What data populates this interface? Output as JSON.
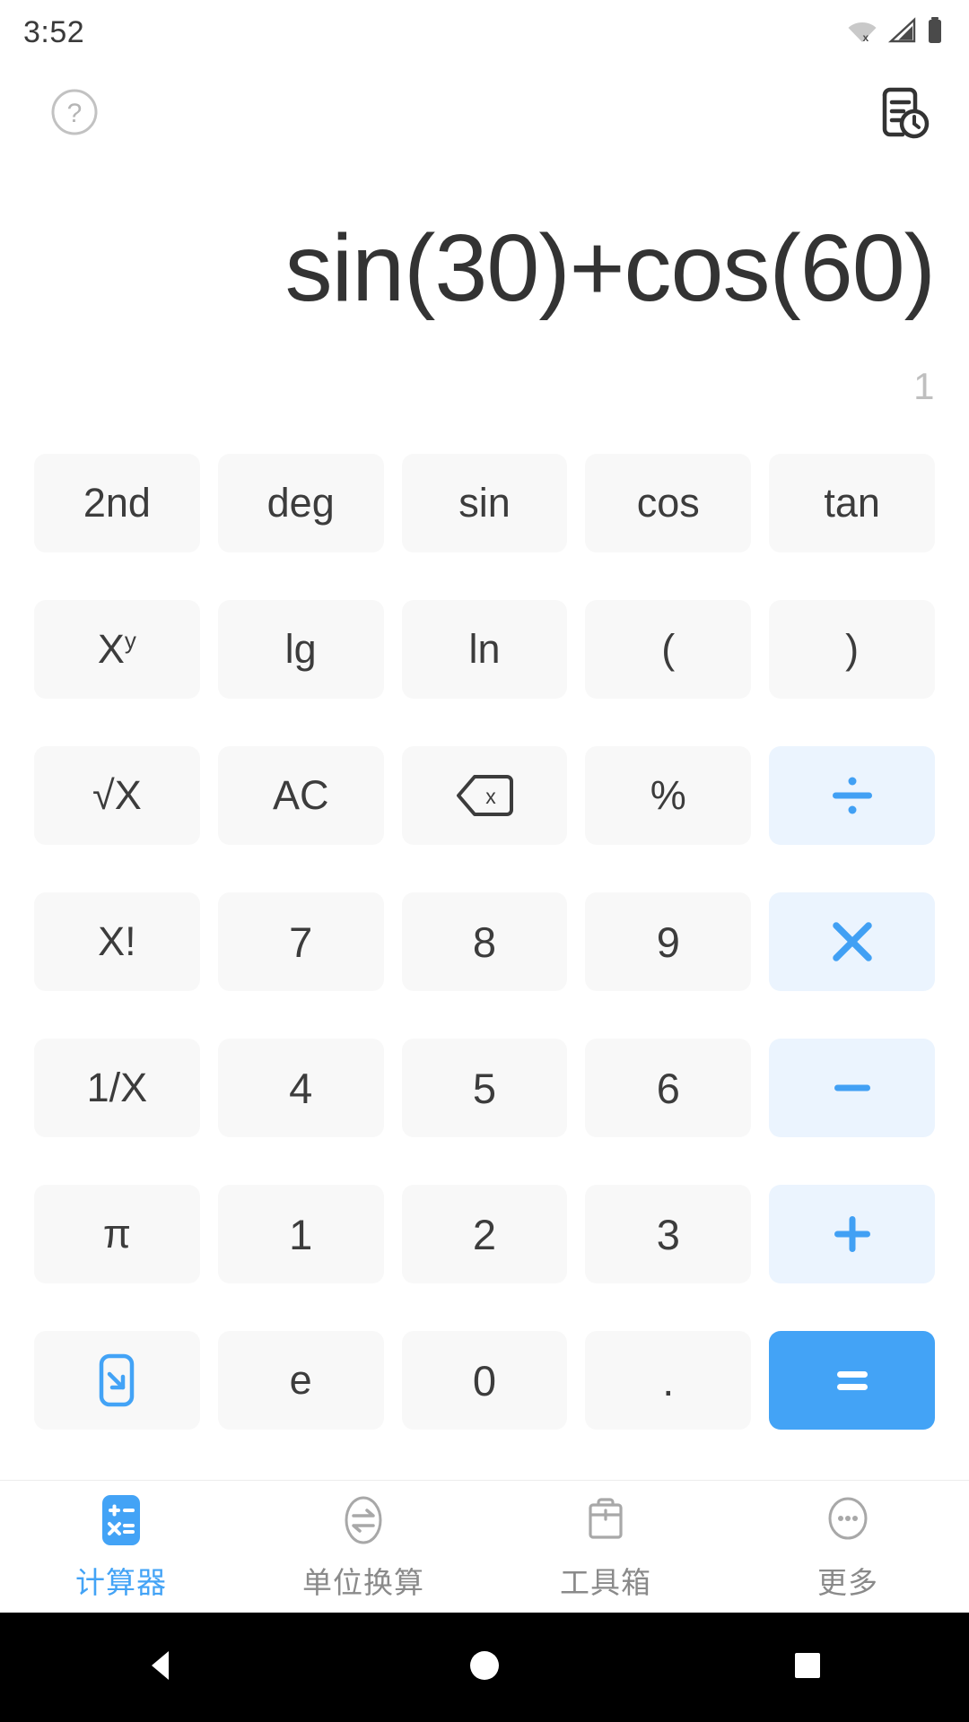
{
  "status_bar": {
    "time": "3:52",
    "icons": [
      "wifi-off-icon",
      "cellular-signal-icon",
      "battery-full-icon"
    ]
  },
  "header": {
    "help_icon": "help-circle-icon",
    "history_icon": "history-document-icon"
  },
  "display": {
    "expression": "sin(30)+cos(60)",
    "result": "1"
  },
  "colors": {
    "accent_blue": "#43A3F6",
    "operator_text": "#41A0F4",
    "operator_bg": "#EBF4FE",
    "key_bg": "#F8F8F8",
    "key_text": "#3C3C3C",
    "expression_text": "#333333",
    "result_text": "#BFBFBF",
    "nav_inactive": "#8A8A8A"
  },
  "keypad": {
    "rows": [
      [
        {
          "label": "2nd",
          "name": "key-second-function",
          "type": "fn"
        },
        {
          "label": "deg",
          "name": "key-degree-mode",
          "type": "fn"
        },
        {
          "label": "sin",
          "name": "key-sine",
          "type": "fn"
        },
        {
          "label": "cos",
          "name": "key-cosine",
          "type": "fn"
        },
        {
          "label": "tan",
          "name": "key-tangent",
          "type": "fn"
        }
      ],
      [
        {
          "label": "X",
          "sup": "y",
          "name": "key-power",
          "type": "fn"
        },
        {
          "label": "lg",
          "name": "key-log10",
          "type": "fn"
        },
        {
          "label": "ln",
          "name": "key-natural-log",
          "type": "fn"
        },
        {
          "label": "(",
          "name": "key-open-paren",
          "type": "fn"
        },
        {
          "label": ")",
          "name": "key-close-paren",
          "type": "fn"
        }
      ],
      [
        {
          "label": "√X",
          "name": "key-square-root",
          "type": "fn"
        },
        {
          "label": "AC",
          "name": "key-all-clear",
          "type": "fn"
        },
        {
          "label": "",
          "name": "key-backspace",
          "type": "icon",
          "icon": "backspace-icon"
        },
        {
          "label": "%",
          "name": "key-percent",
          "type": "fn"
        },
        {
          "label": "÷",
          "name": "key-divide",
          "type": "op",
          "icon": "divide-icon"
        }
      ],
      [
        {
          "label": "X!",
          "name": "key-factorial",
          "type": "fn"
        },
        {
          "label": "7",
          "name": "key-seven",
          "type": "num"
        },
        {
          "label": "8",
          "name": "key-eight",
          "type": "num"
        },
        {
          "label": "9",
          "name": "key-nine",
          "type": "num"
        },
        {
          "label": "×",
          "name": "key-multiply",
          "type": "op",
          "icon": "multiply-icon"
        }
      ],
      [
        {
          "label": "1/X",
          "name": "key-reciprocal",
          "type": "fn"
        },
        {
          "label": "4",
          "name": "key-four",
          "type": "num"
        },
        {
          "label": "5",
          "name": "key-five",
          "type": "num"
        },
        {
          "label": "6",
          "name": "key-six",
          "type": "num"
        },
        {
          "label": "−",
          "name": "key-subtract",
          "type": "op",
          "icon": "minus-icon"
        }
      ],
      [
        {
          "label": "π",
          "name": "key-pi",
          "type": "fn"
        },
        {
          "label": "1",
          "name": "key-one",
          "type": "num"
        },
        {
          "label": "2",
          "name": "key-two",
          "type": "num"
        },
        {
          "label": "3",
          "name": "key-three",
          "type": "num"
        },
        {
          "label": "+",
          "name": "key-add",
          "type": "op",
          "icon": "plus-icon"
        }
      ],
      [
        {
          "label": "",
          "name": "key-collapse-keypad",
          "type": "icon",
          "icon": "collapse-arrow-icon"
        },
        {
          "label": "e",
          "name": "key-euler",
          "type": "fn"
        },
        {
          "label": "0",
          "name": "key-zero",
          "type": "num"
        },
        {
          "label": ".",
          "name": "key-decimal-point",
          "type": "num"
        },
        {
          "label": "=",
          "name": "key-equals",
          "type": "equals",
          "icon": "equals-icon"
        }
      ]
    ]
  },
  "bottom_nav": {
    "items": [
      {
        "label": "计算器",
        "name": "nav-calculator",
        "icon": "calculator-icon",
        "active": true
      },
      {
        "label": "单位换算",
        "name": "nav-unit-conversion",
        "icon": "unit-convert-icon",
        "active": false
      },
      {
        "label": "工具箱",
        "name": "nav-toolbox",
        "icon": "toolbox-icon",
        "active": false
      },
      {
        "label": "更多",
        "name": "nav-more",
        "icon": "more-dots-icon",
        "active": false
      }
    ]
  },
  "system_nav": {
    "back": "back-triangle-icon",
    "home": "home-circle-icon",
    "recents": "recents-square-icon"
  }
}
